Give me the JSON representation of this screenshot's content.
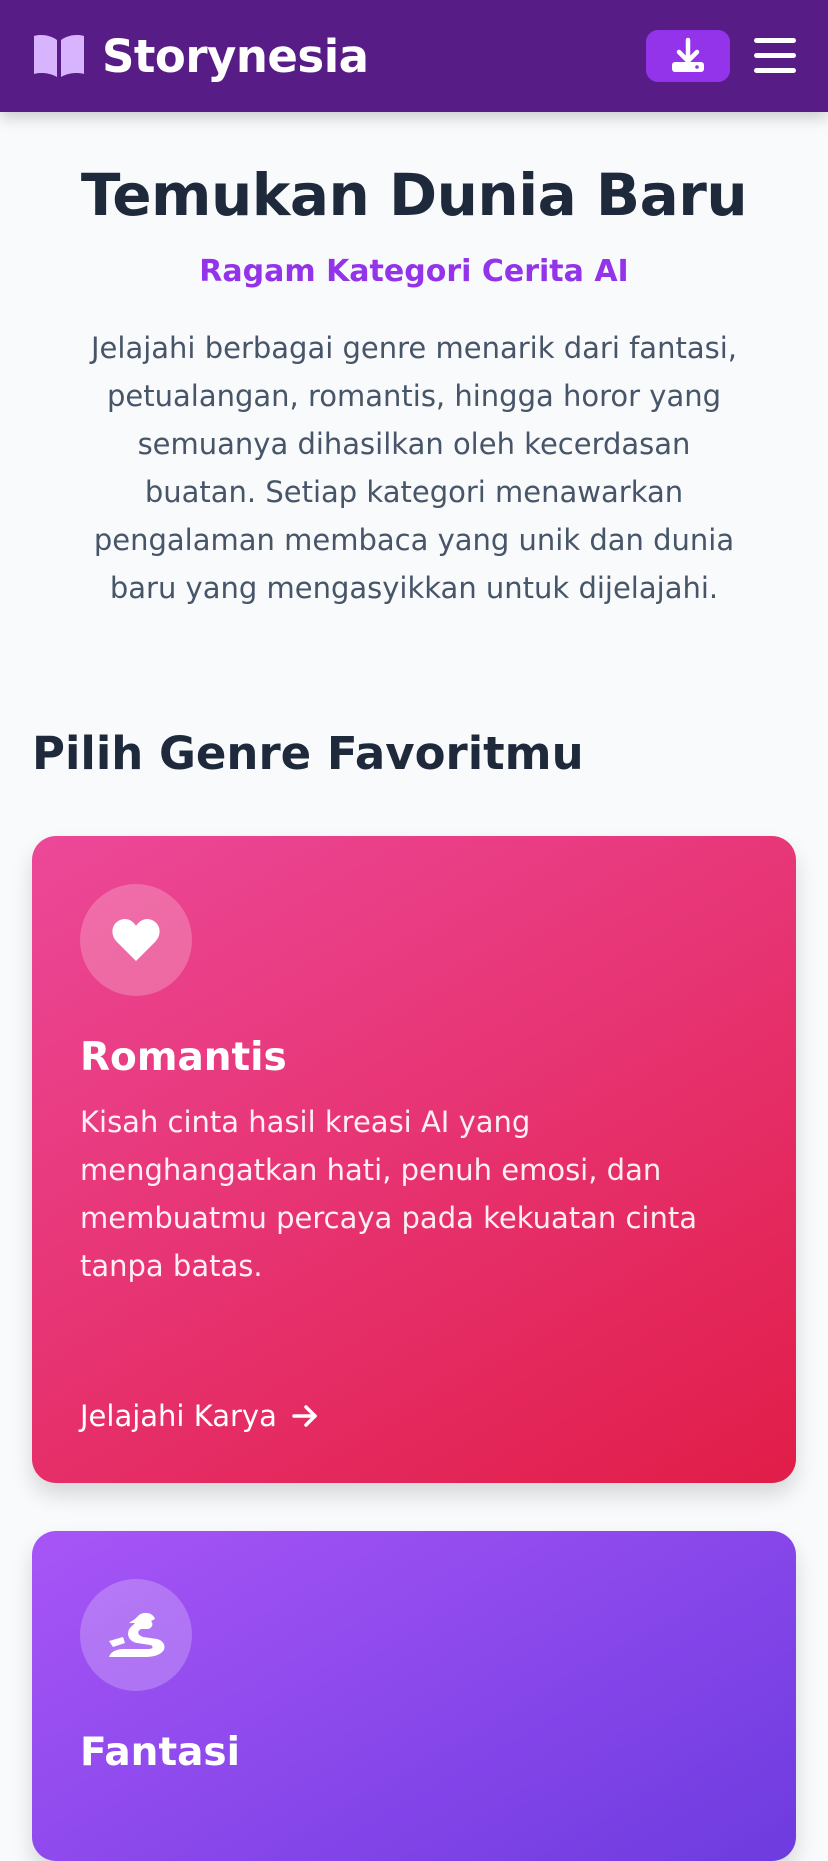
{
  "app": {
    "name": "Storynesia",
    "logo_icon": "open-book-icon",
    "brand_color": "#581c87",
    "accent_color": "#9333ea"
  },
  "navbar": {
    "download_icon": "download-icon",
    "menu_icon": "hamburger-menu-icon"
  },
  "hero": {
    "title": "Temukan Dunia Baru",
    "subtitle": "Ragam Kategori Cerita AI",
    "description": "Jelajahi berbagai genre menarik dari fantasi, petualangan, romantis, hingga horor yang semuanya dihasilkan oleh kecerdasan buatan. Setiap kategori menawarkan pengalaman membaca yang unik dan dunia baru yang mengasyikkan untuk dijelajahi."
  },
  "genres": {
    "heading": "Pilih Genre Favoritmu",
    "items": [
      {
        "title": "Romantis",
        "icon": "heart-icon",
        "description": "Kisah cinta hasil kreasi AI yang menghangatkan hati, penuh emosi, dan membuatmu percaya pada kekuatan cinta tanpa batas.",
        "link_label": "Jelajahi Karya",
        "gradient": [
          "#ec4899",
          "#e11d48"
        ]
      },
      {
        "title": "Fantasi",
        "icon": "dragon-icon",
        "gradient": [
          "#a855f7",
          "#6d3bdf"
        ]
      }
    ]
  }
}
